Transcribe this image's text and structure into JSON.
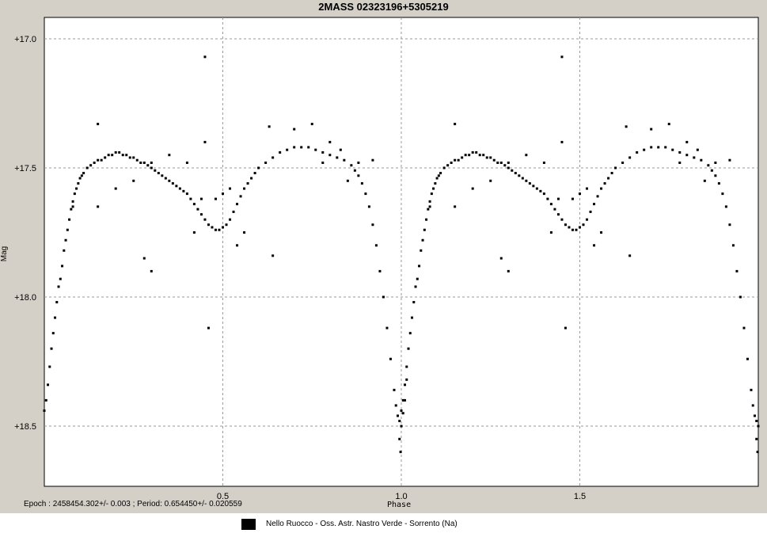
{
  "chart_data": {
    "type": "scatter",
    "title": "2MASS  02323196+5305219",
    "xlabel": "Phase",
    "ylabel": "Mag",
    "xlim": [
      0,
      2
    ],
    "ylim": [
      18.7,
      16.9
    ],
    "y_inverted": true,
    "x_ticks": [
      "0.5",
      "1.0",
      "1.5"
    ],
    "x_tick_values": [
      0.5,
      1.0,
      1.5
    ],
    "y_ticks": [
      "+17.0",
      "+17.5",
      "+18.0",
      "+18.5"
    ],
    "y_tick_values": [
      17.0,
      17.5,
      18.0,
      18.5
    ],
    "grid": true,
    "epoch_text": "Epoch : 2458454.302+/- 0.003 ; Period: 0.654450+/- 0.020559",
    "legend": [
      {
        "label": "Nello Ruocco - Oss. Astr. Nastro Verde - Sorrento (Na)",
        "color": "#000000"
      }
    ],
    "series": [
      {
        "color": "#000000",
        "points": [
          [
            0.0,
            18.44
          ],
          [
            0.005,
            18.4
          ],
          [
            0.01,
            18.34
          ],
          [
            0.015,
            18.27
          ],
          [
            0.02,
            18.2
          ],
          [
            0.025,
            18.14
          ],
          [
            0.03,
            18.08
          ],
          [
            0.035,
            18.02
          ],
          [
            0.04,
            17.96
          ],
          [
            0.045,
            17.93
          ],
          [
            0.05,
            17.88
          ],
          [
            0.055,
            17.82
          ],
          [
            0.06,
            17.78
          ],
          [
            0.065,
            17.74
          ],
          [
            0.07,
            17.7
          ],
          [
            0.075,
            17.66
          ],
          [
            0.08,
            17.63
          ],
          [
            0.085,
            17.6
          ],
          [
            0.09,
            17.58
          ],
          [
            0.095,
            17.56
          ],
          [
            0.1,
            17.54
          ],
          [
            0.105,
            17.53
          ],
          [
            0.11,
            17.52
          ],
          [
            0.12,
            17.5
          ],
          [
            0.13,
            17.49
          ],
          [
            0.14,
            17.48
          ],
          [
            0.15,
            17.47
          ],
          [
            0.16,
            17.47
          ],
          [
            0.17,
            17.46
          ],
          [
            0.18,
            17.45
          ],
          [
            0.19,
            17.45
          ],
          [
            0.2,
            17.44
          ],
          [
            0.21,
            17.44
          ],
          [
            0.22,
            17.45
          ],
          [
            0.23,
            17.45
          ],
          [
            0.24,
            17.46
          ],
          [
            0.25,
            17.46
          ],
          [
            0.26,
            17.47
          ],
          [
            0.27,
            17.48
          ],
          [
            0.28,
            17.48
          ],
          [
            0.29,
            17.49
          ],
          [
            0.3,
            17.5
          ],
          [
            0.31,
            17.51
          ],
          [
            0.32,
            17.52
          ],
          [
            0.33,
            17.53
          ],
          [
            0.34,
            17.54
          ],
          [
            0.35,
            17.55
          ],
          [
            0.36,
            17.56
          ],
          [
            0.37,
            17.57
          ],
          [
            0.38,
            17.58
          ],
          [
            0.39,
            17.59
          ],
          [
            0.4,
            17.6
          ],
          [
            0.41,
            17.62
          ],
          [
            0.42,
            17.64
          ],
          [
            0.43,
            17.66
          ],
          [
            0.44,
            17.68
          ],
          [
            0.45,
            17.7
          ],
          [
            0.46,
            17.72
          ],
          [
            0.47,
            17.73
          ],
          [
            0.48,
            17.74
          ],
          [
            0.49,
            17.74
          ],
          [
            0.5,
            17.73
          ],
          [
            0.51,
            17.72
          ],
          [
            0.52,
            17.7
          ],
          [
            0.53,
            17.67
          ],
          [
            0.54,
            17.64
          ],
          [
            0.55,
            17.61
          ],
          [
            0.56,
            17.58
          ],
          [
            0.57,
            17.56
          ],
          [
            0.58,
            17.54
          ],
          [
            0.59,
            17.52
          ],
          [
            0.6,
            17.5
          ],
          [
            0.62,
            17.48
          ],
          [
            0.64,
            17.46
          ],
          [
            0.66,
            17.44
          ],
          [
            0.68,
            17.43
          ],
          [
            0.7,
            17.42
          ],
          [
            0.72,
            17.42
          ],
          [
            0.74,
            17.42
          ],
          [
            0.76,
            17.43
          ],
          [
            0.78,
            17.44
          ],
          [
            0.8,
            17.45
          ],
          [
            0.82,
            17.46
          ],
          [
            0.84,
            17.47
          ],
          [
            0.86,
            17.49
          ],
          [
            0.87,
            17.51
          ],
          [
            0.88,
            17.53
          ],
          [
            0.89,
            17.56
          ],
          [
            0.9,
            17.6
          ],
          [
            0.91,
            17.65
          ],
          [
            0.92,
            17.72
          ],
          [
            0.93,
            17.8
          ],
          [
            0.94,
            17.9
          ],
          [
            0.95,
            18.0
          ],
          [
            0.96,
            18.12
          ],
          [
            0.97,
            18.24
          ],
          [
            0.98,
            18.36
          ],
          [
            0.985,
            18.42
          ],
          [
            0.99,
            18.46
          ],
          [
            0.995,
            18.48
          ],
          [
            1.0,
            18.5
          ],
          [
            1.005,
            18.45
          ],
          [
            1.01,
            18.4
          ],
          [
            1.015,
            18.32
          ],
          [
            0.45,
            17.07
          ],
          [
            0.46,
            18.12
          ],
          [
            0.28,
            17.85
          ],
          [
            0.3,
            17.9
          ],
          [
            0.63,
            17.34
          ],
          [
            0.64,
            17.84
          ],
          [
            0.15,
            17.33
          ],
          [
            0.08,
            17.65
          ],
          [
            0.998,
            18.6
          ],
          [
            0.995,
            18.55
          ],
          [
            0.42,
            17.75
          ],
          [
            0.44,
            17.62
          ],
          [
            0.5,
            17.6
          ],
          [
            0.52,
            17.58
          ],
          [
            0.54,
            17.8
          ],
          [
            0.56,
            17.75
          ],
          [
            0.15,
            17.65
          ],
          [
            0.2,
            17.58
          ],
          [
            0.25,
            17.55
          ],
          [
            0.3,
            17.48
          ],
          [
            0.35,
            17.45
          ],
          [
            0.4,
            17.48
          ],
          [
            0.45,
            17.4
          ],
          [
            0.48,
            17.62
          ],
          [
            0.7,
            17.35
          ],
          [
            0.75,
            17.33
          ],
          [
            0.78,
            17.48
          ],
          [
            0.8,
            17.4
          ],
          [
            0.83,
            17.43
          ],
          [
            0.85,
            17.55
          ],
          [
            0.88,
            17.48
          ],
          [
            0.92,
            17.47
          ]
        ]
      }
    ]
  }
}
